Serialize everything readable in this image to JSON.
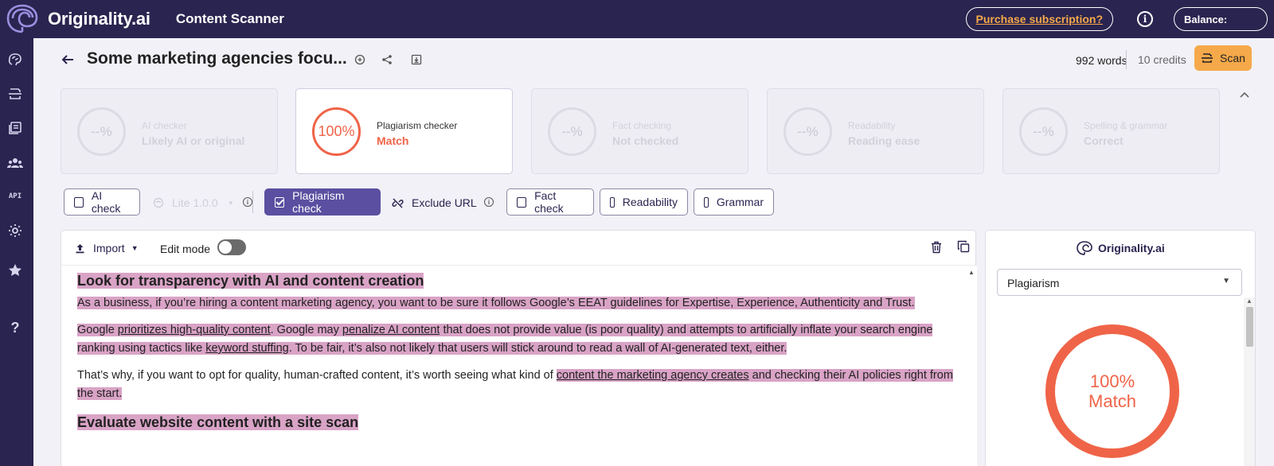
{
  "topbar": {
    "brand": "Originality.ai",
    "app_title": "Content Scanner",
    "purchase_label": "Purchase subscription?",
    "info_glyph": "i",
    "balance_label": "Balance:"
  },
  "sidebar": {
    "items": [
      {
        "icon": "brain-icon"
      },
      {
        "icon": "scan-document-icon"
      },
      {
        "icon": "library-icon"
      },
      {
        "icon": "team-icon"
      },
      {
        "icon": "api-icon",
        "label": "API"
      },
      {
        "icon": "settings-icon"
      },
      {
        "icon": "star-icon"
      },
      {
        "icon": "help-icon",
        "label": "?"
      }
    ]
  },
  "document": {
    "title": "Some marketing agencies focu...",
    "words": "992 words",
    "credits": "10 credits",
    "scan_label": "Scan"
  },
  "score_cards": [
    {
      "value": "--%",
      "label": "AI checker",
      "result": "Likely AI or original",
      "active": false
    },
    {
      "value": "100%",
      "label": "Plagiarism checker",
      "result": "Match",
      "active": true
    },
    {
      "value": "--%",
      "label": "Fact checking",
      "result": "Not checked",
      "active": false
    },
    {
      "value": "--%",
      "label": "Readability",
      "result": "Reading ease",
      "active": false
    },
    {
      "value": "--%",
      "label": "Spelling & grammar",
      "result": "Correct",
      "active": false
    }
  ],
  "check_toggles": {
    "ai_check": "AI check",
    "lite_model": "Lite 1.0.0",
    "plagiarism_check": "Plagiarism check",
    "exclude_url": "Exclude URL",
    "fact_check": "Fact check",
    "readability": "Readability",
    "grammar": "Grammar"
  },
  "editor": {
    "import_label": "Import",
    "edit_mode_label": "Edit mode",
    "edit_mode_on": false,
    "content": {
      "h1": "Look for transparency with AI and content creation",
      "p1": "As a business, if you’re hiring a content marketing agency, you want to be sure it follows Google’s EEAT guidelines for Expertise, Experience, Authenticity and Trust.",
      "p2_a": "Google ",
      "p2_link1": "prioritizes high-quality content",
      "p2_b": ".   Google may ",
      "p2_link2": "penalize AI content",
      "p2_c": " that does not provide value (is poor quality) and attempts to artificially inflate your search engine ranking using tactics like ",
      "p2_link3": "keyword stuffing",
      "p2_d": ".   To be fair, it’s also not likely that users will stick around to read a wall of AI-generated text, either.",
      "p3_a": " That’s why, if you want to opt for quality, human-crafted content, it’s worth seeing what kind of ",
      "p3_link": "content the marketing agency creates",
      "p3_b": " and checking their AI policies right from the start.",
      "h2": "Evaluate website content with a site scan"
    }
  },
  "result_panel": {
    "brand": "Originality.ai",
    "mode_selected": "Plagiarism",
    "score": "100%",
    "score_label": "Match"
  },
  "colors": {
    "brand_navy": "#2a2450",
    "accent_orange": "#f5a94a",
    "match_red": "#ef6448",
    "highlight": "#d9a3c6",
    "toggle_active": "#5a4fa0"
  }
}
